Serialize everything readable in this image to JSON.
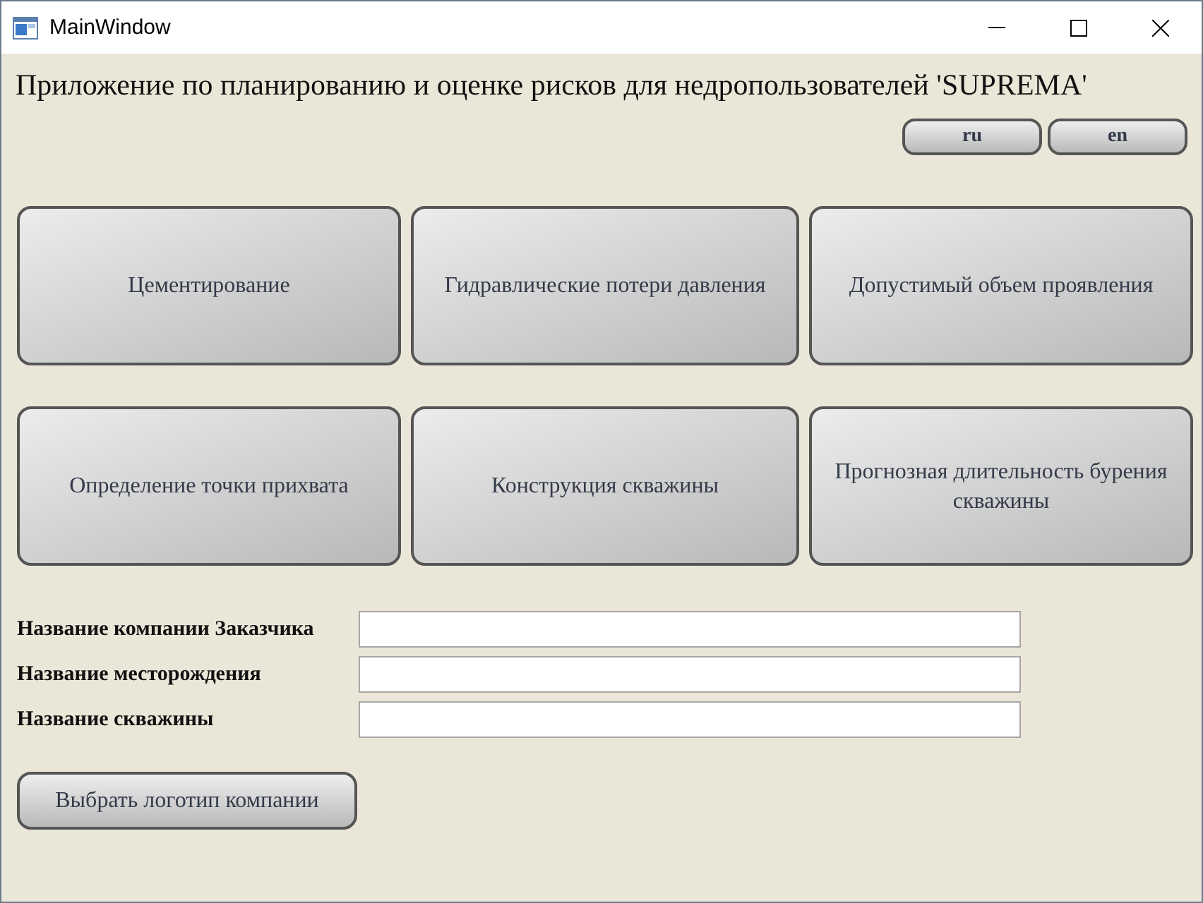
{
  "window": {
    "title": "MainWindow"
  },
  "heading": "Приложение по планированию и оценке рисков для недропользователей 'SUPREMA'",
  "languages": [
    {
      "label": "ru"
    },
    {
      "label": "en"
    }
  ],
  "modules": [
    {
      "label": "Цементирование"
    },
    {
      "label": "Гидравлические потери давления"
    },
    {
      "label": "Допустимый объем проявления"
    },
    {
      "label": "Определение точки прихвата"
    },
    {
      "label": "Конструкция скважины"
    },
    {
      "label": "Прогнозная длительность бурения скважины"
    }
  ],
  "fields": [
    {
      "label": "Название компании Заказчика"
    },
    {
      "label": "Название месторождения"
    },
    {
      "label": "Название скважины"
    }
  ],
  "logo_button": "Выбрать логотип компании"
}
